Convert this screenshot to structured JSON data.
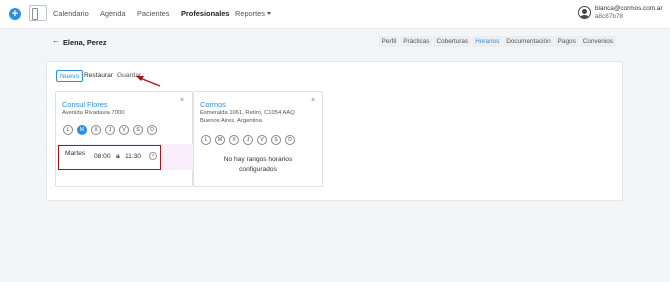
{
  "header": {
    "plus_icon": "plus-icon",
    "nav": [
      "Calendario",
      "Agenda",
      "Pacientes",
      "Profesionales",
      "Reportes"
    ],
    "active_nav": "Profesionales",
    "user": {
      "email": "bianca@cormos.com.ar",
      "id": "a8c87b78",
      "icon": "user-icon"
    }
  },
  "subheader": {
    "back_icon": "arrow-left-icon",
    "name": "Elena, Perez",
    "tabs": [
      "Perfil",
      "Prácticas",
      "Coberturas",
      "Horarios",
      "Documentación",
      "Pagos",
      "Convenios"
    ],
    "active_tab": "Horarios"
  },
  "toolbar": {
    "nuevo": "Nuevo",
    "restaurar": "Restaurar",
    "guardar": "Guardar"
  },
  "cards": [
    {
      "title": "Consul Flores",
      "address": [
        "Avenida Rivadavia 7000"
      ],
      "close": "×",
      "days": [
        "L",
        "M",
        "X",
        "J",
        "V",
        "S",
        "D"
      ],
      "selected_day": "M",
      "schedule": {
        "day": "Martes",
        "from": "08:00",
        "sep": "a",
        "to": "11:30",
        "remove_icon": "close-circle-icon"
      }
    },
    {
      "title": "Cormos",
      "address": [
        "Esmeralda 1061, Retiro, C1054 AAQ",
        "Buenos Aires, Argentina"
      ],
      "close": "×",
      "days": [
        "L",
        "M",
        "X",
        "J",
        "V",
        "S",
        "D"
      ],
      "selected_day": "",
      "empty_message": [
        "No hay rangos horarios",
        "configurados"
      ]
    }
  ],
  "colors": {
    "accent": "#2f8fde",
    "annotation": "#a4161a",
    "row_highlight": "#fbeefc"
  }
}
